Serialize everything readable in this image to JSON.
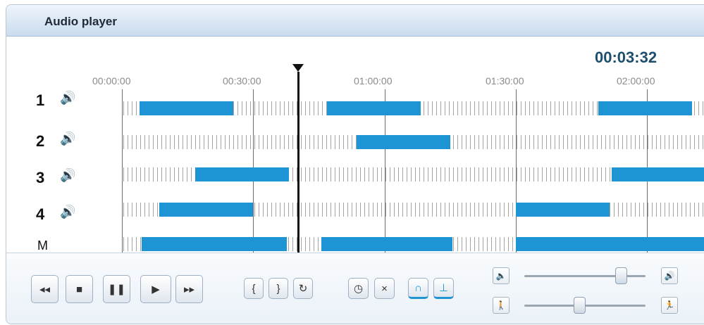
{
  "window": {
    "title": "Audio player"
  },
  "status": {
    "timecode": "00:03:32"
  },
  "timeline": {
    "ticks": [
      "00:00:00",
      "00:30:00",
      "01:00:00",
      "01:30:00",
      "02:00:00"
    ],
    "tracks": [
      {
        "label": "1"
      },
      {
        "label": "2"
      },
      {
        "label": "3"
      },
      {
        "label": "4"
      },
      {
        "label": "M"
      }
    ]
  },
  "controls": {
    "transport": [
      {
        "symbol": "◂◂"
      },
      {
        "symbol": "■"
      },
      {
        "symbol": "❚❚"
      },
      {
        "symbol": "▶"
      },
      {
        "symbol": "▸▸"
      }
    ],
    "markers": [
      {
        "symbol": "{"
      },
      {
        "symbol": "}"
      },
      {
        "symbol": "↻"
      }
    ],
    "tools": [
      {
        "symbol": "◷"
      },
      {
        "symbol": "×"
      },
      {
        "symbol": "∩"
      },
      {
        "symbol": "⊥"
      }
    ],
    "sliders": {
      "volume_min_icon": "speaker-low-icon",
      "volume_max_icon": "speaker-high-icon",
      "speed_min_icon": "walk-icon",
      "speed_max_icon": "run-icon"
    }
  },
  "colors": {
    "segment": "#1f94d5",
    "timer": "#1e4e6e",
    "titlebar": "#c9dced"
  }
}
